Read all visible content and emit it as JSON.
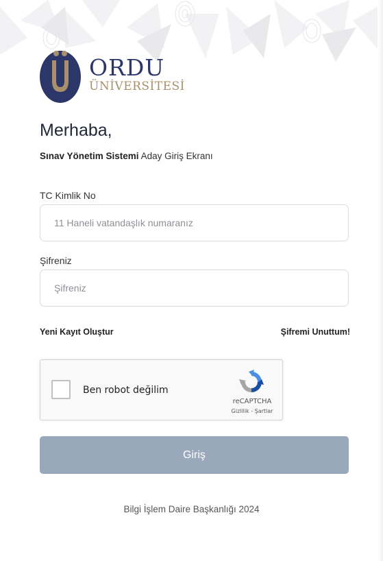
{
  "brand": {
    "name": "ORDU",
    "subname": "ÜNİVERSİTESİ",
    "colors": {
      "navy": "#2c3669",
      "gold": "#a98f6a"
    }
  },
  "greeting": "Merhaba,",
  "subtitle": {
    "bold": "Sınav Yönetim Sistemi",
    "rest": " Aday Giriş Ekranı"
  },
  "form": {
    "tc_label": "TC Kimlik No",
    "tc_placeholder": "11 Haneli vatandaşlık numaranız",
    "password_label": "Şifreniz",
    "password_placeholder": "Şifreniz"
  },
  "links": {
    "register": "Yeni Kayıt Oluştur",
    "forgot": "Şifremi Unuttum!"
  },
  "captcha": {
    "label": "Ben robot değilim",
    "brand": "reCAPTCHA",
    "links": "Gizlilik - Şartlar"
  },
  "submit": {
    "label": "Giriş",
    "color": "#9aa8bb"
  },
  "footer": "Bilgi İşlem Daire Başkanlığı 2024"
}
